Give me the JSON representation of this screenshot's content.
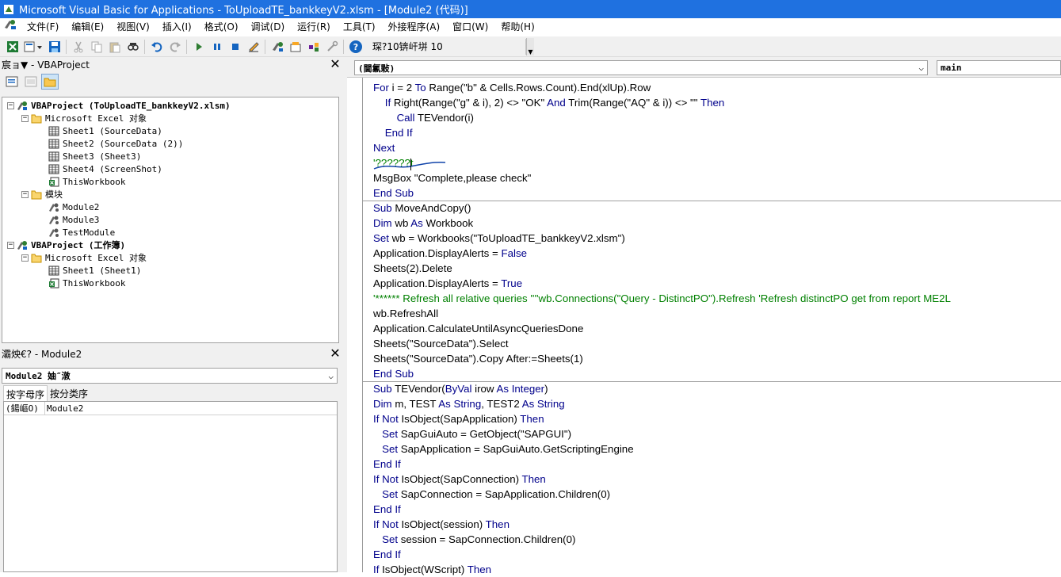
{
  "window": {
    "title": "Microsoft Visual Basic for Applications - ToUploadTE_bankkeyV2.xlsm - [Module2 (代码)]"
  },
  "menu": [
    "文件(F)",
    "编辑(E)",
    "视图(V)",
    "插入(I)",
    "格式(O)",
    "调试(D)",
    "运行(R)",
    "工具(T)",
    "外接程序(A)",
    "窗口(W)",
    "帮助(H)"
  ],
  "toolbar": {
    "status": "琛?10锛屽垪 10"
  },
  "project_pane": {
    "title": "宸ョ▼ - VBAProject",
    "tree": [
      {
        "label": "VBAProject (ToUploadTE_bankkeyV2.xlsm)",
        "level": 0,
        "icon": "vbaproject-icon",
        "exp": "−",
        "bold": true
      },
      {
        "label": "Microsoft Excel 对象",
        "level": 1,
        "icon": "folder-icon",
        "exp": "−"
      },
      {
        "label": "Sheet1 (SourceData)",
        "level": 2,
        "icon": "sheet-icon"
      },
      {
        "label": "Sheet2 (SourceData (2))",
        "level": 2,
        "icon": "sheet-icon"
      },
      {
        "label": "Sheet3 (Sheet3)",
        "level": 2,
        "icon": "sheet-icon"
      },
      {
        "label": "Sheet4 (ScreenShot)",
        "level": 2,
        "icon": "sheet-icon"
      },
      {
        "label": "ThisWorkbook",
        "level": 2,
        "icon": "workbook-icon"
      },
      {
        "label": "模块",
        "level": 1,
        "icon": "folder-icon",
        "exp": "−"
      },
      {
        "label": "Module2",
        "level": 2,
        "icon": "module-icon"
      },
      {
        "label": "Module3",
        "level": 2,
        "icon": "module-icon"
      },
      {
        "label": "TestModule",
        "level": 2,
        "icon": "module-icon"
      },
      {
        "label": "VBAProject (工作簿)",
        "level": 0,
        "icon": "vbaproject-icon",
        "exp": "−",
        "bold": true
      },
      {
        "label": "Microsoft Excel 对象",
        "level": 1,
        "icon": "folder-icon",
        "exp": "−"
      },
      {
        "label": "Sheet1 (Sheet1)",
        "level": 2,
        "icon": "sheet-icon"
      },
      {
        "label": "ThisWorkbook",
        "level": 2,
        "icon": "workbook-icon"
      }
    ]
  },
  "properties_pane": {
    "title": "灞炴€? - Module2",
    "object": "Module2 妯″潡",
    "tabs": [
      "按字母序",
      "按分类序"
    ],
    "rows": [
      {
        "key": "(鍚嶇О)",
        "value": "Module2"
      }
    ]
  },
  "code_pane": {
    "object_combo": "(閫氱敤)",
    "proc_combo": "main",
    "blocks": [
      [
        [
          {
            "t": "For",
            "c": "kw"
          },
          {
            "t": " i = 2 "
          },
          {
            "t": "To",
            "c": "kw"
          },
          {
            "t": " Range(\"b\" & Cells.Rows.Count).End(xlUp).Row"
          }
        ],
        [
          {
            "t": "    "
          },
          {
            "t": "If",
            "c": "kw"
          },
          {
            "t": " Right(Range(\"g\" & i), 2) <> \"OK\" "
          },
          {
            "t": "And",
            "c": "kw"
          },
          {
            "t": " Trim(Range(\"AQ\" & i)) <> \"\" "
          },
          {
            "t": "Then",
            "c": "kw"
          }
        ],
        [
          {
            "t": "        "
          },
          {
            "t": "Call",
            "c": "kw"
          },
          {
            "t": " TEVendor(i)"
          }
        ],
        [
          {
            "t": "    "
          },
          {
            "t": "End If",
            "c": "kw"
          }
        ],
        [
          {
            "t": "Next",
            "c": "kw"
          }
        ],
        [
          {
            "t": "'??????t",
            "c": "cm"
          }
        ],
        [
          {
            "t": "MsgBox \"Complete,please check\""
          }
        ],
        [
          {
            "t": "End Sub",
            "c": "kw"
          }
        ]
      ],
      [
        [
          {
            "t": "Sub",
            "c": "kw"
          },
          {
            "t": " MoveAndCopy()"
          }
        ],
        [
          {
            "t": "Dim",
            "c": "kw"
          },
          {
            "t": " wb "
          },
          {
            "t": "As",
            "c": "kw"
          },
          {
            "t": " Workbook"
          }
        ],
        [
          {
            "t": "Set",
            "c": "kw"
          },
          {
            "t": " wb = Workbooks(\"ToUploadTE_bankkeyV2.xlsm\")"
          }
        ],
        [
          {
            "t": "Application.DisplayAlerts = "
          },
          {
            "t": "False",
            "c": "kw"
          }
        ],
        [
          {
            "t": "Sheets(2).Delete"
          }
        ],
        [
          {
            "t": "Application.DisplayAlerts = "
          },
          {
            "t": "True",
            "c": "kw"
          }
        ],
        [
          {
            "t": "'****** Refresh all relative queries ''''wb.Connections(\"Query - DistinctPO\").Refresh 'Refresh distinctPO get from report ME2L",
            "c": "cm"
          }
        ],
        [
          {
            "t": "wb.RefreshAll"
          }
        ],
        [
          {
            "t": "Application.CalculateUntilAsyncQueriesDone"
          }
        ],
        [
          {
            "t": "Sheets(\"SourceData\").Select"
          }
        ],
        [
          {
            "t": "Sheets(\"SourceData\").Copy After:=Sheets(1)"
          }
        ],
        [
          {
            "t": "End Sub",
            "c": "kw"
          }
        ]
      ],
      [
        [
          {
            "t": "Sub",
            "c": "kw"
          },
          {
            "t": " TEVendor("
          },
          {
            "t": "ByVal",
            "c": "kw"
          },
          {
            "t": " irow "
          },
          {
            "t": "As Integer",
            "c": "kw"
          },
          {
            "t": ")"
          }
        ],
        [
          {
            "t": "Dim",
            "c": "kw"
          },
          {
            "t": " m, TEST "
          },
          {
            "t": "As String",
            "c": "kw"
          },
          {
            "t": ", TEST2 "
          },
          {
            "t": "As String",
            "c": "kw"
          }
        ],
        [
          {
            "t": "If Not",
            "c": "kw"
          },
          {
            "t": " IsObject(SapApplication) "
          },
          {
            "t": "Then",
            "c": "kw"
          }
        ],
        [
          {
            "t": "   "
          },
          {
            "t": "Set",
            "c": "kw"
          },
          {
            "t": " SapGuiAuto = GetObject(\"SAPGUI\")"
          }
        ],
        [
          {
            "t": "   "
          },
          {
            "t": "Set",
            "c": "kw"
          },
          {
            "t": " SapApplication = SapGuiAuto.GetScriptingEngine"
          }
        ],
        [
          {
            "t": "End If",
            "c": "kw"
          }
        ],
        [
          {
            "t": "If Not",
            "c": "kw"
          },
          {
            "t": " IsObject(SapConnection) "
          },
          {
            "t": "Then",
            "c": "kw"
          }
        ],
        [
          {
            "t": "   "
          },
          {
            "t": "Set",
            "c": "kw"
          },
          {
            "t": " SapConnection = SapApplication.Children(0)"
          }
        ],
        [
          {
            "t": "End If",
            "c": "kw"
          }
        ],
        [
          {
            "t": "If Not",
            "c": "kw"
          },
          {
            "t": " IsObject(session) "
          },
          {
            "t": "Then",
            "c": "kw"
          }
        ],
        [
          {
            "t": "   "
          },
          {
            "t": "Set",
            "c": "kw"
          },
          {
            "t": " session = SapConnection.Children(0)"
          }
        ],
        [
          {
            "t": "End If",
            "c": "kw"
          }
        ],
        [
          {
            "t": "If",
            "c": "kw"
          },
          {
            "t": " IsObject(WScript) "
          },
          {
            "t": "Then",
            "c": "kw"
          }
        ]
      ]
    ]
  }
}
